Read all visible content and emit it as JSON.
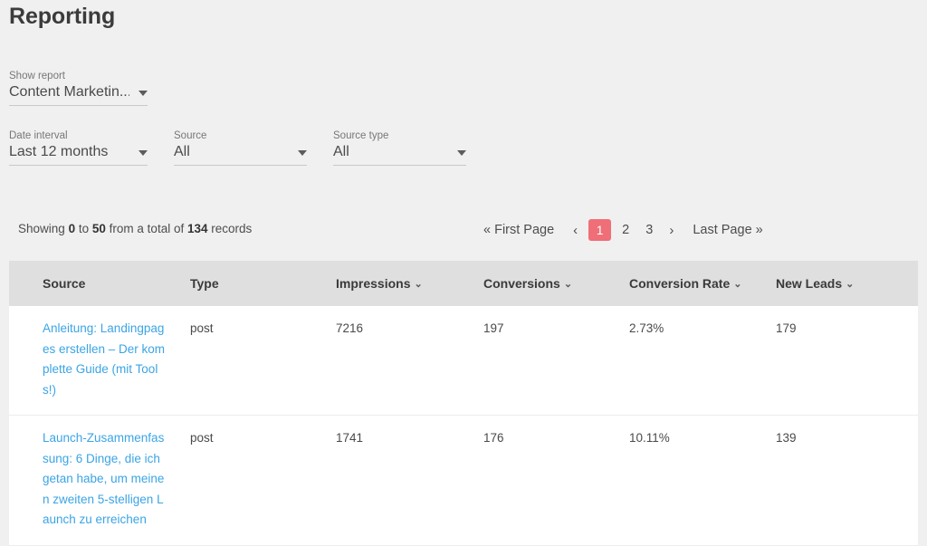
{
  "page": {
    "title": "Reporting",
    "background": "#f0f0f0",
    "accent": "#ef6e77",
    "link_color": "#3ba4e5"
  },
  "filters": {
    "report": {
      "label": "Show report",
      "value": "Content Marketin...",
      "caret": "caret-down-icon"
    },
    "date_interval": {
      "label": "Date interval",
      "value": "Last 12 months",
      "caret": "caret-down-icon"
    },
    "source": {
      "label": "Source",
      "value": "All",
      "caret": "caret-down-icon"
    },
    "source_type": {
      "label": "Source type",
      "value": "All",
      "caret": "caret-down-icon"
    }
  },
  "records_info": {
    "prefix": "Showing",
    "from": "0",
    "middle": "to",
    "to": "50",
    "suffix": "from a total of",
    "total": "134",
    "unit": "records"
  },
  "pagination": {
    "first": "« First Page",
    "prev": "‹",
    "pages": [
      "1",
      "2",
      "3"
    ],
    "active_page": "1",
    "next": "›",
    "last": "Last Page »"
  },
  "table": {
    "columns": [
      {
        "label": "Source",
        "sortable": false
      },
      {
        "label": "Type",
        "sortable": false
      },
      {
        "label": "Impressions",
        "sortable": true
      },
      {
        "label": "Conversions",
        "sortable": true
      },
      {
        "label": "Conversion Rate",
        "sortable": true
      },
      {
        "label": "New Leads",
        "sortable": true
      }
    ],
    "sort_caret": "⌄",
    "rows": [
      {
        "source": "Anleitung: Landingpages erstellen – Der komplette Guide (mit Tools!)",
        "type": "post",
        "impressions": "7216",
        "conversions": "197",
        "conversion_rate": "2.73%",
        "new_leads": "179"
      },
      {
        "source": "Launch-Zusammenfassung: 6 Dinge, die ich getan habe, um meinen zweiten 5-stelligen Launch zu erreichen",
        "type": "post",
        "impressions": "1741",
        "conversions": "176",
        "conversion_rate": "10.11%",
        "new_leads": "139"
      }
    ]
  }
}
